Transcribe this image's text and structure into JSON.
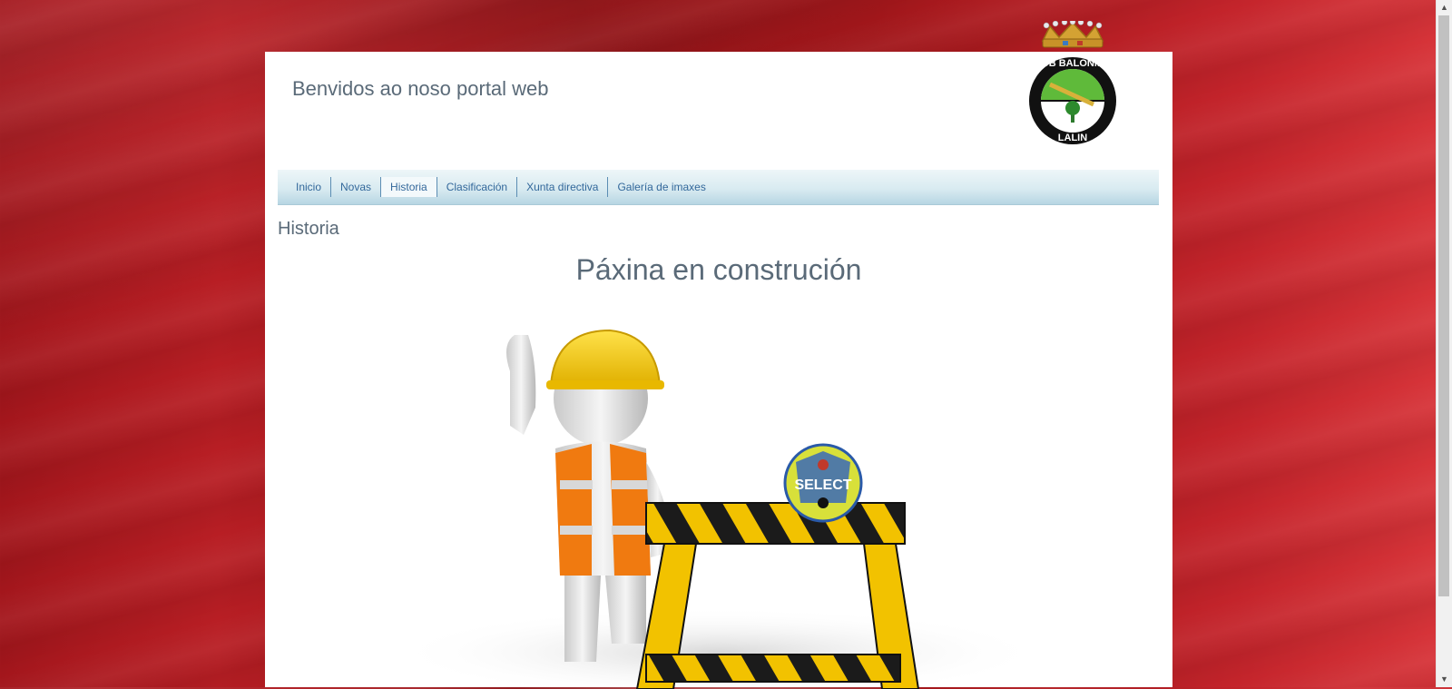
{
  "header": {
    "site_title": "Benvidos ao noso portal web",
    "logo": {
      "name": "club-logo",
      "text_top": "CLUB BALONMAN",
      "text_bottom": "LALIN"
    }
  },
  "nav": {
    "items": [
      {
        "label": "Inicio",
        "active": false
      },
      {
        "label": "Novas",
        "active": false
      },
      {
        "label": "Historia",
        "active": true
      },
      {
        "label": "Clasificación",
        "active": false
      },
      {
        "label": "Xunta directiva",
        "active": false
      },
      {
        "label": "Galería de imaxes",
        "active": false
      }
    ]
  },
  "main": {
    "section_heading": "Historia",
    "construction_title": "Páxina en construción",
    "illustration": {
      "name": "under-construction-illustration",
      "ball_text": "SELECT"
    }
  },
  "colors": {
    "background_red": "#a3161c",
    "nav_gradient_top": "#eef6f8",
    "nav_gradient_bottom": "#b7d6e3",
    "nav_text": "#33689b",
    "heading_text": "#5a6a78"
  }
}
